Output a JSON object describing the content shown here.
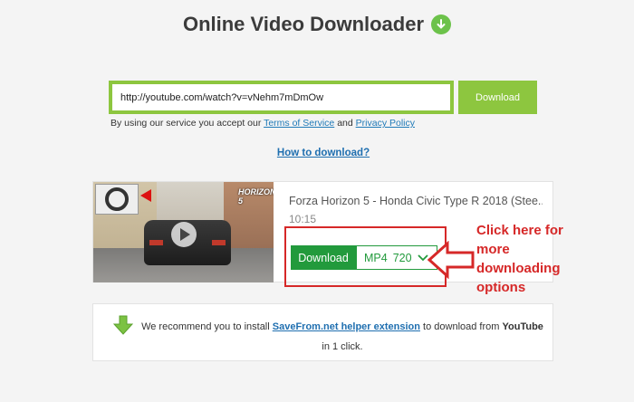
{
  "header": {
    "title": "Online Video Downloader",
    "icon": "download-arrow-icon",
    "accent_color": "#6cc24a"
  },
  "search": {
    "url_value": "http://youtube.com/watch?v=vNehm7mDmOw",
    "download_label": "Download",
    "border_color": "#8dc63f"
  },
  "terms": {
    "prefix": "By using our service you accept our",
    "terms_link": "Terms of Service",
    "and": "and",
    "privacy_link": "Privacy Policy"
  },
  "help": {
    "how_link": "How to download?"
  },
  "result": {
    "title": "Forza Horizon 5 - Honda Civic Type R 2018 (Stee...",
    "duration": "10:15",
    "thumbnail_badge": "HORIZON 5",
    "download_label": "Download",
    "format": "MP4",
    "quality": "720",
    "download_color": "#229a3c"
  },
  "annotation": {
    "text": "Click here for more downloading options",
    "color": "#d62828"
  },
  "recommend": {
    "prefix": "We recommend you to install",
    "link": "SaveFrom.net helper extension",
    "middle": "to download from",
    "site": "YouTube",
    "suffix": "in 1 click.",
    "icon": "green-down-arrow-icon"
  }
}
